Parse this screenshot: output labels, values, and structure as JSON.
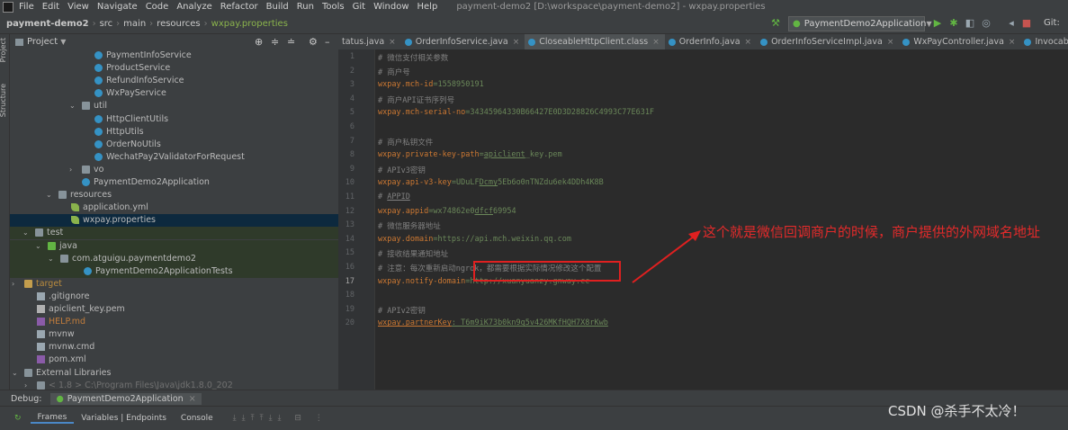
{
  "menubar": {
    "items": [
      "File",
      "Edit",
      "View",
      "Navigate",
      "Code",
      "Analyze",
      "Refactor",
      "Build",
      "Run",
      "Tools",
      "Git",
      "Window",
      "Help"
    ],
    "window_title": "payment-demo2 [D:\\workspace\\payment-demo2] - wxpay.properties"
  },
  "breadcrumb": {
    "project": "payment-demo2",
    "parts": [
      "src",
      "main",
      "resources"
    ],
    "file": "wxpay.properties"
  },
  "run_config": "PaymentDemo2Application",
  "toolbar": {
    "git_label": "Git:"
  },
  "left_strip": {
    "project": "Project",
    "structure": "Structure"
  },
  "project_panel": {
    "title": "Project",
    "rows": [
      {
        "label": "PaymentInfoService",
        "indent": 94,
        "icon": "cls",
        "arrow": ""
      },
      {
        "label": "ProductService",
        "indent": 94,
        "icon": "cls",
        "arrow": ""
      },
      {
        "label": "RefundInfoService",
        "indent": 94,
        "icon": "cls",
        "arrow": ""
      },
      {
        "label": "WxPayService",
        "indent": 94,
        "icon": "cls",
        "arrow": ""
      },
      {
        "label": "util",
        "indent": 80,
        "icon": "folder",
        "arrow": "v"
      },
      {
        "label": "HttpClientUtils",
        "indent": 94,
        "icon": "cls",
        "arrow": ""
      },
      {
        "label": "HttpUtils",
        "indent": 94,
        "icon": "cls",
        "arrow": ""
      },
      {
        "label": "OrderNoUtils",
        "indent": 94,
        "icon": "cls",
        "arrow": ""
      },
      {
        "label": "WechatPay2ValidatorForRequest",
        "indent": 94,
        "icon": "cls",
        "arrow": ""
      },
      {
        "label": "vo",
        "indent": 80,
        "icon": "folder",
        "arrow": ">"
      },
      {
        "label": "PaymentDemo2Application",
        "indent": 80,
        "icon": "cls",
        "arrow": ""
      },
      {
        "label": "resources",
        "indent": 54,
        "icon": "folder",
        "arrow": "v"
      },
      {
        "label": "application.yml",
        "indent": 68,
        "icon": "leaf",
        "arrow": ""
      },
      {
        "label": "wxpay.properties",
        "indent": 68,
        "icon": "leaf",
        "arrow": "",
        "selected": true
      },
      {
        "label": "test",
        "indent": 28,
        "icon": "folder",
        "arrow": "v",
        "hl": true
      },
      {
        "label": "java",
        "indent": 42,
        "icon": "gfolder",
        "arrow": "v",
        "hl": true
      },
      {
        "label": "com.atguigu.paymentdemo2",
        "indent": 56,
        "icon": "folder",
        "arrow": "v",
        "hl": true
      },
      {
        "label": "PaymentDemo2ApplicationTests",
        "indent": 82,
        "icon": "cls",
        "arrow": "",
        "hl": true
      },
      {
        "label": "target",
        "indent": 16,
        "icon": "yfolder",
        "arrow": ">",
        "color": "#b98b3e"
      },
      {
        "label": ".gitignore",
        "indent": 30,
        "icon": "file",
        "arrow": ""
      },
      {
        "label": "apiclient_key.pem",
        "indent": 30,
        "icon": "pem",
        "arrow": ""
      },
      {
        "label": "HELP.md",
        "indent": 30,
        "icon": "md",
        "arrow": "",
        "color": "#c27d3c"
      },
      {
        "label": "mvnw",
        "indent": 30,
        "icon": "file",
        "arrow": ""
      },
      {
        "label": "mvnw.cmd",
        "indent": 30,
        "icon": "file",
        "arrow": ""
      },
      {
        "label": "pom.xml",
        "indent": 30,
        "icon": "md",
        "arrow": ""
      },
      {
        "label": "External Libraries",
        "indent": 16,
        "icon": "folder",
        "arrow": "v"
      },
      {
        "label": "< 1.8 >  C:\\Program Files\\Java\\jdk1.8.0_202",
        "indent": 30,
        "icon": "folder",
        "arrow": ">",
        "color": "#707070"
      }
    ]
  },
  "editor_tabs": [
    {
      "label": "tatus.java"
    },
    {
      "label": "OrderInfoService.java"
    },
    {
      "label": "CloseableHttpClient.class",
      "active": true
    },
    {
      "label": "OrderInfo.java"
    },
    {
      "label": "OrderInfoServiceImpl.java"
    },
    {
      "label": "WxPayController.java"
    },
    {
      "label": "InvocableHandlerMethod.cla"
    }
  ],
  "editor": {
    "lines": [
      {
        "n": "1",
        "segs": [
          {
            "t": "# 微信支付相关参数",
            "c": "cm"
          }
        ]
      },
      {
        "n": "2",
        "segs": [
          {
            "t": "# 商户号",
            "c": "cm"
          }
        ]
      },
      {
        "n": "3",
        "segs": [
          {
            "t": "wxpay.mch-id",
            "c": "ky"
          },
          {
            "t": "=1558950191",
            "c": "vl"
          }
        ]
      },
      {
        "n": "4",
        "segs": [
          {
            "t": "# 商户API证书序列号",
            "c": "cm"
          }
        ]
      },
      {
        "n": "5",
        "segs": [
          {
            "t": "wxpay.mch-serial-no",
            "c": "ky"
          },
          {
            "t": "=34345964330B66427E0D3D28826C4993C77E631F",
            "c": "vl"
          }
        ]
      },
      {
        "n": "6",
        "segs": []
      },
      {
        "n": "7",
        "segs": [
          {
            "t": "# 商户私钥文件",
            "c": "cm"
          }
        ]
      },
      {
        "n": "8",
        "segs": [
          {
            "t": "wxpay.private-key-path",
            "c": "ky"
          },
          {
            "t": "=",
            "c": "vl"
          },
          {
            "t": "apiclient",
            "c": "vl ul"
          },
          {
            "t": "_key.pem",
            "c": "vl"
          }
        ]
      },
      {
        "n": "9",
        "segs": [
          {
            "t": "# APIv3密钥",
            "c": "cm"
          }
        ]
      },
      {
        "n": "10",
        "segs": [
          {
            "t": "wxpay.api-v3-key",
            "c": "ky"
          },
          {
            "t": "=UDuLF",
            "c": "vl"
          },
          {
            "t": "Dcmy",
            "c": "vl ul"
          },
          {
            "t": "5Eb6o0nTNZdu6ek4DDh4K8B",
            "c": "vl"
          }
        ]
      },
      {
        "n": "11",
        "segs": [
          {
            "t": "# ",
            "c": "cm"
          },
          {
            "t": "APPID",
            "c": "cm ul"
          }
        ]
      },
      {
        "n": "12",
        "segs": [
          {
            "t": "wxpay.appid",
            "c": "ky"
          },
          {
            "t": "=wx74862e0",
            "c": "vl"
          },
          {
            "t": "dfcf",
            "c": "vl ul"
          },
          {
            "t": "69954",
            "c": "vl"
          }
        ]
      },
      {
        "n": "13",
        "segs": [
          {
            "t": "# 微信服务器地址",
            "c": "cm"
          }
        ]
      },
      {
        "n": "14",
        "segs": [
          {
            "t": "wxpay.domain",
            "c": "ky"
          },
          {
            "t": "=https://api.mch.weixin.qq.com",
            "c": "vl"
          }
        ]
      },
      {
        "n": "15",
        "segs": [
          {
            "t": "# 接收结果通知地址",
            "c": "cm"
          }
        ]
      },
      {
        "n": "16",
        "segs": [
          {
            "t": "# 注意：每次重新启动ngrok，都需要根据实际情况修改这个配置",
            "c": "cm"
          }
        ]
      },
      {
        "n": "17",
        "segs": [
          {
            "t": "wxpay.notify-domain",
            "c": "ky"
          },
          {
            "t": "=http://xuanyuanzy.gnway.cc",
            "c": "vl"
          }
        ]
      },
      {
        "n": "18",
        "segs": []
      },
      {
        "n": "19",
        "segs": [
          {
            "t": "# APIv2密钥",
            "c": "cm"
          }
        ]
      },
      {
        "n": "20",
        "segs": [
          {
            "t": "wxpay.partnerKey",
            "c": "ky ul"
          },
          {
            "t": ": T6m9iK73b0kn9g5v426MKfHQH7X8rKwb",
            "c": "vl ul"
          }
        ]
      }
    ]
  },
  "annotation": {
    "text": "这个就是微信回调商户的时候，商户提供的外网域名地址",
    "color": "#e32b2b"
  },
  "debug": {
    "label": "Debug:",
    "config": "PaymentDemo2Application",
    "tabs": [
      "Frames",
      "Variables | Endpoints",
      "Console"
    ]
  },
  "watermark": "CSDN @杀手不太冷！"
}
